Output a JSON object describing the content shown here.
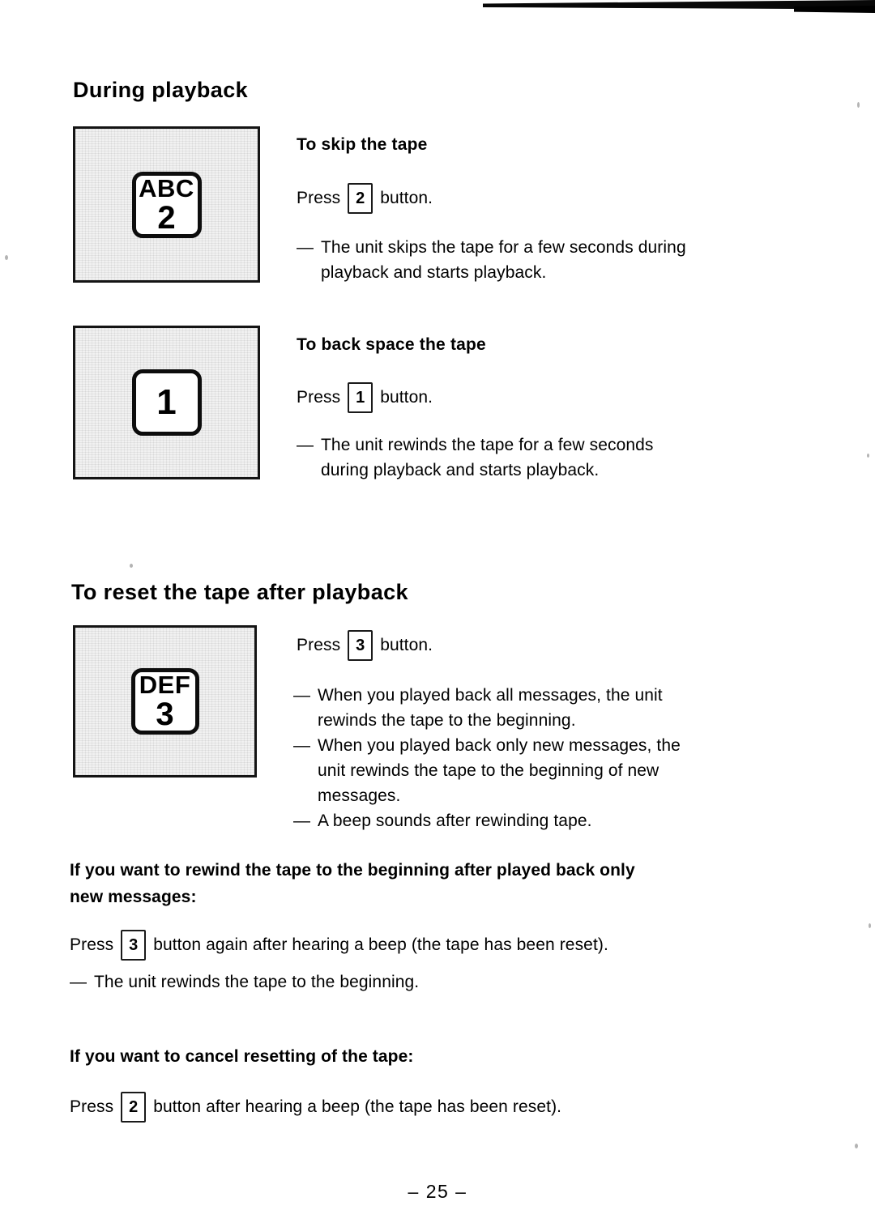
{
  "page": {
    "number_label": "– 25 –"
  },
  "sections": [
    {
      "heading": "During playback",
      "blocks": [
        {
          "illustration": {
            "letters": "ABC",
            "digit": "2"
          },
          "subheading": "To skip the tape",
          "press": {
            "prefix": "Press",
            "key": "2",
            "suffix": "button."
          },
          "notes": [
            {
              "dash": "—",
              "lines": [
                "The unit skips the tape for a few seconds during",
                "playback and starts playback."
              ]
            }
          ]
        },
        {
          "illustration": {
            "letters": "",
            "digit": "1"
          },
          "subheading": "To back space the tape",
          "press": {
            "prefix": "Press",
            "key": "1",
            "suffix": "button."
          },
          "notes": [
            {
              "dash": "—",
              "lines": [
                "The unit rewinds the tape for a few seconds",
                "during playback and starts playback."
              ]
            }
          ]
        }
      ]
    },
    {
      "heading": "To reset the tape after playback",
      "blocks": [
        {
          "illustration": {
            "letters": "DEF",
            "digit": "3"
          },
          "subheading": "",
          "press": {
            "prefix": "Press",
            "key": "3",
            "suffix": "button."
          },
          "notes": [
            {
              "dash": "—",
              "lines": [
                "When you played back all messages, the unit",
                "rewinds the tape to the beginning."
              ]
            },
            {
              "dash": "—",
              "lines": [
                "When you played back only new messages, the",
                "unit rewinds the tape to the beginning of new",
                "messages."
              ]
            },
            {
              "dash": "—",
              "lines": [
                "A beep sounds after rewinding tape."
              ]
            }
          ]
        }
      ]
    }
  ],
  "footnotes": [
    {
      "bold_lines": [
        "If you want to rewind the tape to the beginning after played back only",
        "new messages:"
      ],
      "press": {
        "prefix": "Press",
        "key": "3",
        "suffix": "button again after hearing a beep (the tape has been reset)."
      },
      "note": {
        "dash": "—",
        "lines": [
          "The unit rewinds the tape to the beginning."
        ]
      }
    },
    {
      "bold_lines": [
        "If you want to cancel resetting of the tape:"
      ],
      "press": {
        "prefix": "Press",
        "key": "2",
        "suffix": "button after hearing a beep (the tape has been reset)."
      },
      "note": null
    }
  ]
}
